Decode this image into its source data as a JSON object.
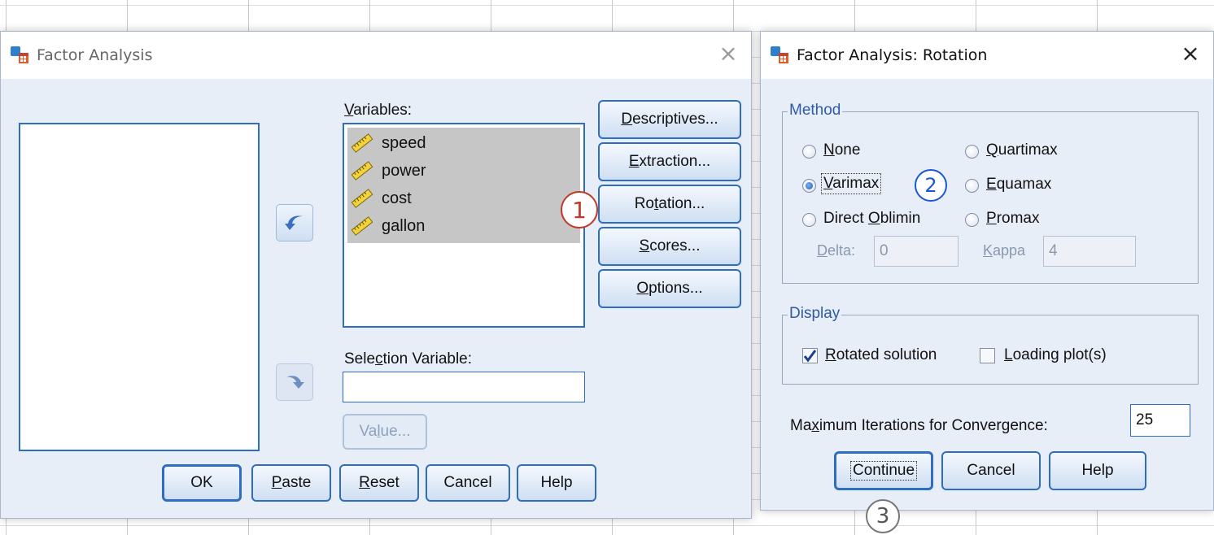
{
  "factor_dialog": {
    "title": "Factor Analysis",
    "close_glyph": "×",
    "variables_label_pre": "",
    "variables_label_u": "V",
    "variables_label_post": "ariables:",
    "variables": [
      "speed",
      "power",
      "cost",
      "gallon"
    ],
    "variable_icon": "ruler-icon",
    "selection_label_pre": "Sele",
    "selection_label_u": "c",
    "selection_label_post": "tion Variable:",
    "selection_value": "",
    "value_button": {
      "pre": "Va",
      "u": "l",
      "post": "ue..."
    },
    "side_buttons": [
      {
        "pre": "",
        "u": "D",
        "post": "escriptives..."
      },
      {
        "pre": "",
        "u": "E",
        "post": "xtraction..."
      },
      {
        "pre": "Ro",
        "u": "t",
        "post": "ation..."
      },
      {
        "pre": "",
        "u": "S",
        "post": "cores..."
      },
      {
        "pre": "",
        "u": "O",
        "post": "ptions..."
      }
    ],
    "bottom_buttons": [
      {
        "pre": "OK",
        "u": "",
        "post": ""
      },
      {
        "pre": "",
        "u": "P",
        "post": "aste"
      },
      {
        "pre": "",
        "u": "R",
        "post": "eset"
      },
      {
        "pre": "Cancel",
        "u": "",
        "post": ""
      },
      {
        "pre": "Help",
        "u": "",
        "post": ""
      }
    ]
  },
  "rotation_dialog": {
    "title": "Factor Analysis: Rotation",
    "close_glyph": "×",
    "method_legend": "Method",
    "methods": [
      {
        "pre": "",
        "u": "N",
        "post": "one",
        "checked": false
      },
      {
        "pre": "",
        "u": "Q",
        "post": "uartimax",
        "checked": false
      },
      {
        "pre": "",
        "u": "V",
        "post": "arimax",
        "checked": true
      },
      {
        "pre": "",
        "u": "E",
        "post": "quamax",
        "checked": false
      },
      {
        "pre": "Direct ",
        "u": "O",
        "post": "blimin",
        "checked": false
      },
      {
        "pre": "",
        "u": "P",
        "post": "romax",
        "checked": false
      }
    ],
    "delta_label": {
      "pre": "",
      "u": "D",
      "post": "elta:"
    },
    "delta_value": "0",
    "kappa_label": {
      "pre": "",
      "u": "K",
      "post": "appa"
    },
    "kappa_value": "4",
    "display_legend": "Display",
    "rotated_solution": {
      "pre": "",
      "u": "R",
      "post": "otated solution",
      "checked": true
    },
    "loading_plots": {
      "pre": "",
      "u": "L",
      "post": "oading plot(s)",
      "checked": false
    },
    "max_iter_label": {
      "pre": "Ma",
      "u": "x",
      "post": "imum Iterations for Convergence:"
    },
    "max_iter_value": "25",
    "buttons": [
      "Continue",
      "Cancel",
      "Help"
    ]
  },
  "annotations": {
    "step1": "1",
    "step2": "2",
    "step3": "3",
    "step1_color": "#c0392b",
    "step2_color": "#1a56d6",
    "step3_color": "#555555"
  },
  "colors": {
    "dialog_bg": "#e8eef8",
    "button_border": "#2e6dbf",
    "group_legend": "#2e5aa8",
    "list_selection": "#c6c6c6"
  }
}
